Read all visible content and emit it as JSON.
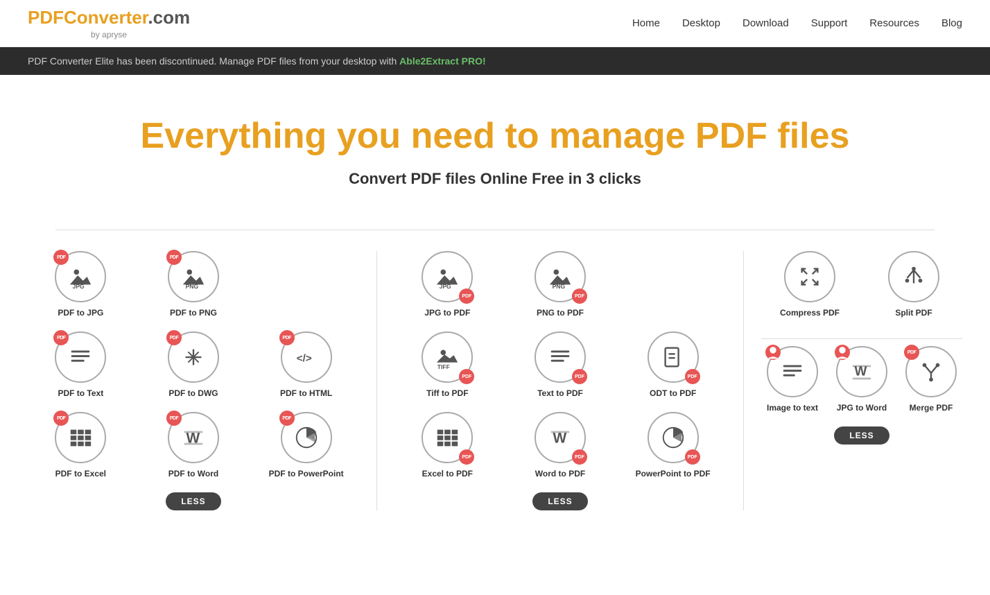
{
  "header": {
    "logo": {
      "pdf": "PDF",
      "converter": "Converter",
      "dotcom": ".com",
      "byApryse": "by apryse"
    },
    "nav": [
      {
        "label": "Home",
        "href": "#"
      },
      {
        "label": "Desktop",
        "href": "#"
      },
      {
        "label": "Download",
        "href": "#"
      },
      {
        "label": "Support",
        "href": "#"
      },
      {
        "label": "Resources",
        "href": "#"
      },
      {
        "label": "Blog",
        "href": "#"
      }
    ]
  },
  "announcement": {
    "text": "PDF Converter Elite has been discontinued. Manage PDF files from your desktop with ",
    "linkText": "Able2Extract PRO!",
    "linkHref": "#"
  },
  "hero": {
    "headline": "Everything you need to manage PDF files",
    "subheadline": "Convert PDF files Online Free in 3 clicks"
  },
  "converters": {
    "leftColumn": [
      {
        "label": "PDF to JPG",
        "iconType": "jpg",
        "pdfBadge": "top-left"
      },
      {
        "label": "PDF to PNG",
        "iconType": "png",
        "pdfBadge": "top-left"
      },
      {
        "label": "PDF to Text",
        "iconType": "text-lines",
        "pdfBadge": "top-left"
      },
      {
        "label": "PDF to DWG",
        "iconType": "dwg",
        "pdfBadge": "top-left"
      },
      {
        "label": "PDF to HTML",
        "iconType": "html",
        "pdfBadge": "top-left"
      },
      {
        "label": "PDF to Excel",
        "iconType": "excel",
        "pdfBadge": "top-left"
      },
      {
        "label": "PDF to Word",
        "iconType": "word",
        "pdfBadge": "top-left"
      },
      {
        "label": "PDF to PowerPoint",
        "iconType": "powerpoint",
        "pdfBadge": "top-left"
      }
    ],
    "middleColumn": [
      {
        "label": "JPG to PDF",
        "iconType": "jpg",
        "pdfBadge": "bottom-right"
      },
      {
        "label": "PNG to PDF",
        "iconType": "png",
        "pdfBadge": "bottom-right"
      },
      {
        "label": "Tiff to PDF",
        "iconType": "tiff",
        "pdfBadge": "bottom-right"
      },
      {
        "label": "Text to PDF",
        "iconType": "text-lines",
        "pdfBadge": "bottom-right"
      },
      {
        "label": "ODT to PDF",
        "iconType": "odt",
        "pdfBadge": "bottom-right"
      },
      {
        "label": "Excel to PDF",
        "iconType": "excel",
        "pdfBadge": "bottom-right"
      },
      {
        "label": "Word to PDF",
        "iconType": "word",
        "pdfBadge": "bottom-right"
      },
      {
        "label": "PowerPoint to PDF",
        "iconType": "powerpoint",
        "pdfBadge": "bottom-right"
      }
    ],
    "rightColumn": [
      {
        "label": "Compress PDF",
        "iconType": "compress"
      },
      {
        "label": "Split PDF",
        "iconType": "split"
      },
      {
        "label": "Image to text",
        "iconType": "image-text",
        "pdfBadge": "top-left"
      },
      {
        "label": "JPG to Word",
        "iconType": "jpg-word",
        "pdfBadge": "top-left"
      },
      {
        "label": "Merge PDF",
        "iconType": "merge",
        "pdfBadge": "top-left"
      }
    ],
    "lessButtonLabel": "LESS"
  }
}
